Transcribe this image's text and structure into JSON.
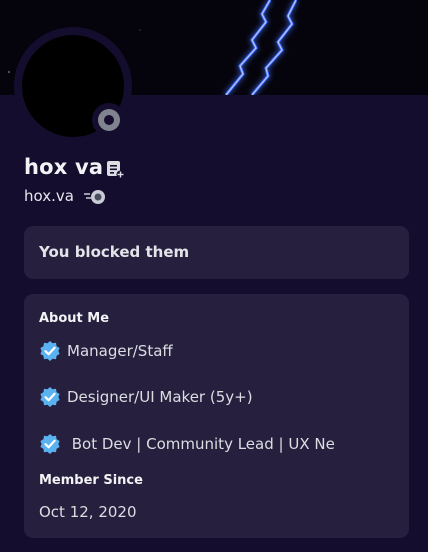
{
  "profile": {
    "display_name": "hox va",
    "username": "hox.va",
    "status": "offline",
    "avatar_color": "#000000",
    "banner_color": "#05040c",
    "accent_color": "#140d2e",
    "icons": {
      "note": "note-icon",
      "quest": "quest-badge-icon",
      "status": "status-offline-icon"
    }
  },
  "blocked": {
    "text": "You blocked them"
  },
  "about": {
    "title": "About Me",
    "lines": [
      "Manager/Staff",
      "Designer/UI Maker (5y+)",
      " Bot Dev | Community Lead | UX Ne"
    ],
    "line_icon": "verified-check-icon",
    "check_color": "#5bb2f0"
  },
  "member_since": {
    "title": "Member Since",
    "date": "Oct 12, 2020"
  }
}
